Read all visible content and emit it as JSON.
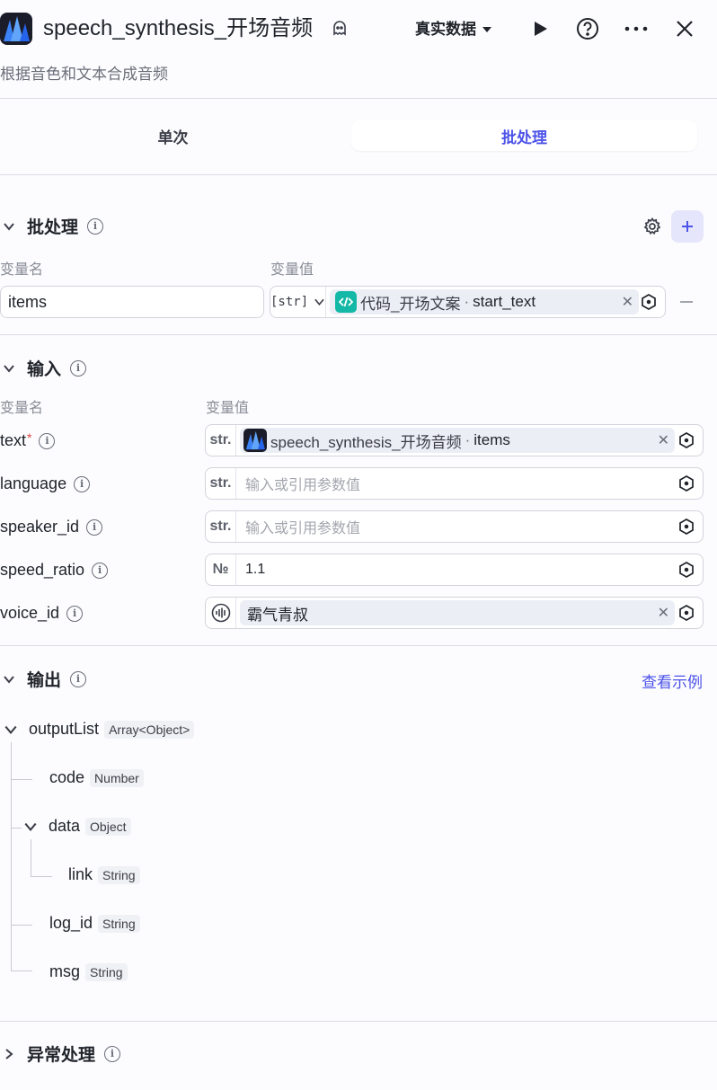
{
  "header": {
    "title": "speech_synthesis_开场音频",
    "data_mode": "真实数据",
    "subtitle": "根据音色和文本合成音频"
  },
  "tabs": [
    {
      "label": "单次",
      "active": false
    },
    {
      "label": "批处理",
      "active": true
    }
  ],
  "batch": {
    "title": "批处理",
    "col_name": "变量名",
    "col_value": "变量值",
    "var_name": "items",
    "type_tag": "[str]",
    "ref_source": "代码_开场文案",
    "ref_sep": "·",
    "ref_field": "start_text"
  },
  "input": {
    "title": "输入",
    "col_name": "变量名",
    "col_value": "变量值",
    "fields": [
      {
        "name": "text",
        "required": true,
        "type": "str.",
        "ref_source": "speech_synthesis_开场音频",
        "ref_sep": "·",
        "ref_field": "items"
      },
      {
        "name": "language",
        "type": "str.",
        "placeholder": "输入或引用参数值"
      },
      {
        "name": "speaker_id",
        "type": "str.",
        "placeholder": "输入或引用参数值"
      },
      {
        "name": "speed_ratio",
        "type": "№",
        "value": "1.1"
      },
      {
        "name": "voice_id",
        "type": "voice-icon",
        "chip": "霸气青叔"
      }
    ]
  },
  "output": {
    "title": "输出",
    "view_example": "查看示例",
    "tree": [
      {
        "name": "outputList",
        "type": "Array<Object>"
      },
      {
        "name": "code",
        "type": "Number"
      },
      {
        "name": "data",
        "type": "Object"
      },
      {
        "name": "link",
        "type": "String"
      },
      {
        "name": "log_id",
        "type": "String"
      },
      {
        "name": "msg",
        "type": "String"
      }
    ]
  },
  "exception": {
    "title": "异常处理"
  },
  "colors": {
    "accent": "#4d53e8",
    "code_icon_bg": "#14b8a6",
    "required": "#e54545"
  },
  "icons": [
    "app-logo",
    "ghost-icon",
    "caret-down-icon",
    "play-icon",
    "help-icon",
    "more-icon",
    "close-icon",
    "chevron-down-icon",
    "chevron-right-icon",
    "info-icon",
    "gear-icon",
    "plus-icon",
    "minus-icon",
    "code-icon",
    "variable-icon",
    "voice-icon"
  ]
}
